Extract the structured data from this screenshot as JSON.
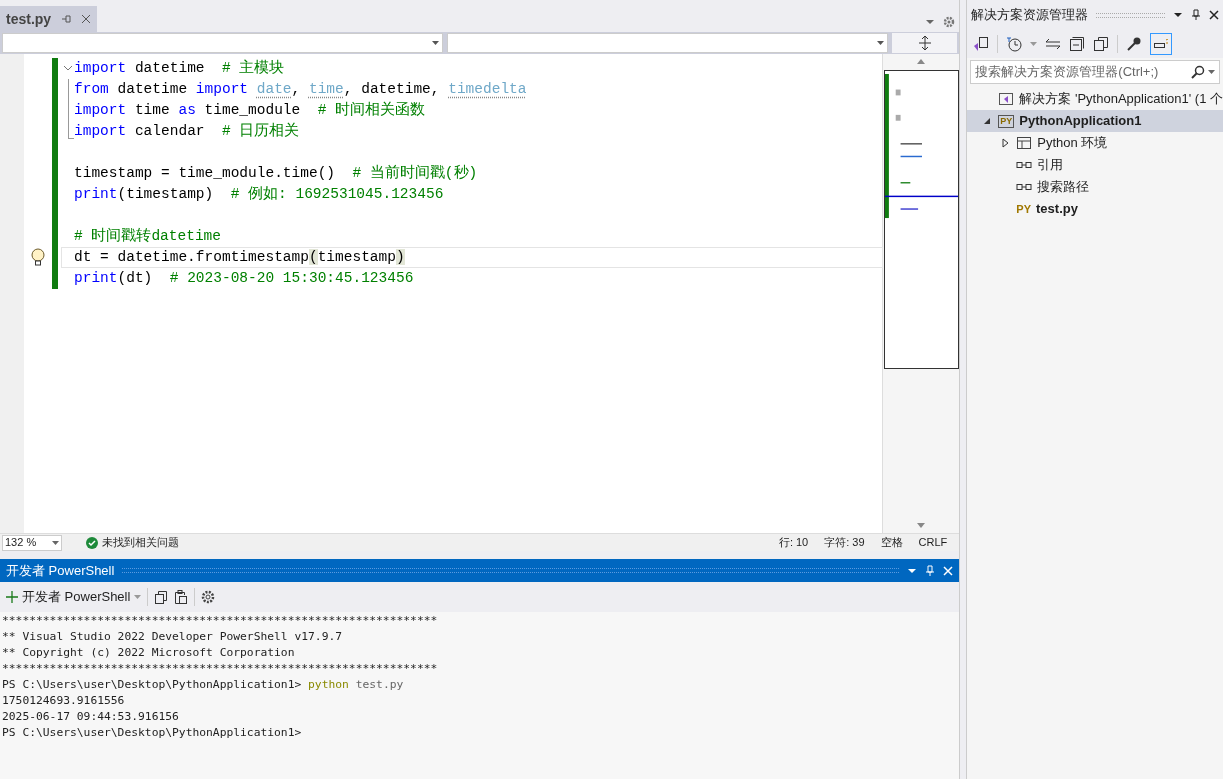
{
  "editor_tab": {
    "title": "test.py",
    "selected": true
  },
  "code_lines": [
    {
      "kind": "fold_start",
      "current": false,
      "lightbulb": false,
      "tokens": [
        {
          "kind": "kw",
          "text": "import"
        },
        {
          "kind": "plain",
          "text": " datetime  "
        },
        {
          "kind": "comment",
          "text": "# 主模块"
        }
      ]
    },
    {
      "kind": "fold_inside",
      "current": false,
      "lightbulb": false,
      "tokens": [
        {
          "kind": "kw",
          "text": "from"
        },
        {
          "kind": "plain",
          "text": " datetime "
        },
        {
          "kind": "kw",
          "text": "import "
        },
        {
          "kind": "unused",
          "text": "date"
        },
        {
          "kind": "plain",
          "text": ", "
        },
        {
          "kind": "unused",
          "text": "time"
        },
        {
          "kind": "plain",
          "text": ", datetime, "
        },
        {
          "kind": "unused",
          "text": "timedelta"
        }
      ]
    },
    {
      "kind": "fold_inside",
      "current": false,
      "lightbulb": false,
      "tokens": [
        {
          "kind": "kw",
          "text": "import"
        },
        {
          "kind": "plain",
          "text": " time "
        },
        {
          "kind": "kw",
          "text": "as"
        },
        {
          "kind": "plain",
          "text": " time_module  "
        },
        {
          "kind": "comment",
          "text": "# 时间相关函数"
        }
      ]
    },
    {
      "kind": "fold_end",
      "current": false,
      "lightbulb": false,
      "tokens": [
        {
          "kind": "kw",
          "text": "import"
        },
        {
          "kind": "plain",
          "text": " calendar  "
        },
        {
          "kind": "comment",
          "text": "# 日历相关"
        }
      ]
    },
    {
      "kind": "plain",
      "current": false,
      "lightbulb": false
    },
    {
      "kind": "plain",
      "current": false,
      "lightbulb": false,
      "tokens": [
        {
          "kind": "plain",
          "text": "timestamp = time_module.time()  "
        },
        {
          "kind": "comment",
          "text": "# 当前时间戳(秒)"
        }
      ]
    },
    {
      "kind": "plain",
      "current": false,
      "lightbulb": false,
      "tokens": [
        {
          "kind": "kw",
          "text": "print"
        },
        {
          "kind": "plain",
          "text": "(timestamp)  "
        },
        {
          "kind": "comment",
          "text": "# 例如: 1692531045.123456"
        }
      ]
    },
    {
      "kind": "plain",
      "current": false,
      "lightbulb": false
    },
    {
      "kind": "plain",
      "current": false,
      "lightbulb": false,
      "tokens": [
        {
          "kind": "comment",
          "text": "# 时间戳转datetime"
        }
      ]
    },
    {
      "kind": "plain",
      "current": true,
      "lightbulb": true,
      "tokens": [
        {
          "kind": "plain",
          "text": "dt = datetime.fromtimestamp"
        },
        {
          "kind": "bracket",
          "text": "("
        },
        {
          "kind": "plain",
          "text": "timestamp"
        },
        {
          "kind": "bracket",
          "text": ")"
        }
      ]
    },
    {
      "kind": "plain",
      "current": false,
      "lightbulb": false,
      "tokens": [
        {
          "kind": "kw",
          "text": "print"
        },
        {
          "kind": "plain",
          "text": "(dt)  "
        },
        {
          "kind": "comment",
          "text": "# 2023-08-20 15:30:45.123456"
        }
      ]
    }
  ],
  "editor_status": {
    "zoom": "132 %",
    "issues": "未找到相关问题",
    "line": "行: 10",
    "char": "字符: 39",
    "indent": "空格",
    "eol": "CRLF"
  },
  "terminal": {
    "title": "开发者 PowerShell",
    "new_button": "开发者 PowerShell",
    "lines": [
      [
        {
          "kind": "text",
          "text": "****************************************************************"
        }
      ],
      [
        {
          "kind": "text",
          "text": "** Visual Studio 2022 Developer PowerShell v17.9.7"
        }
      ],
      [
        {
          "kind": "text",
          "text": "** Copyright (c) 2022 Microsoft Corporation"
        }
      ],
      [
        {
          "kind": "text",
          "text": "****************************************************************"
        }
      ],
      [
        {
          "kind": "text",
          "text": "PS C:\\Users\\user\\Desktop\\PythonApplication1> "
        },
        {
          "kind": "cmd",
          "text": "python"
        },
        {
          "kind": "arg",
          "text": " test.py"
        }
      ],
      [
        {
          "kind": "text",
          "text": "1750124693.9161556"
        }
      ],
      [
        {
          "kind": "text",
          "text": "2025-06-17 09:44:53.916156"
        }
      ],
      [
        {
          "kind": "text",
          "text": "PS C:\\Users\\user\\Desktop\\PythonApplication1>"
        }
      ]
    ]
  },
  "solution_explorer": {
    "title": "解决方案资源管理器",
    "search": {
      "placeholder": "搜索解决方案资源管理器(Ctrl+;)"
    },
    "tree": [
      {
        "kind": "solution",
        "label": "解决方案 'PythonApplication1' (1 个",
        "selected": false,
        "children": [
          {
            "kind": "project",
            "icon_text": "PY",
            "label": "PythonApplication1",
            "selected": true,
            "expanded": true,
            "children": [
              {
                "kind": "env",
                "label": "Python 环境",
                "selected": false,
                "expanded": false
              },
              {
                "kind": "ref",
                "label": "引用",
                "selected": false
              },
              {
                "kind": "ref",
                "label": "搜索路径",
                "selected": false
              },
              {
                "kind": "pyfile",
                "icon_text": "PY",
                "label": "test.py",
                "selected": false
              }
            ]
          }
        ]
      }
    ]
  }
}
